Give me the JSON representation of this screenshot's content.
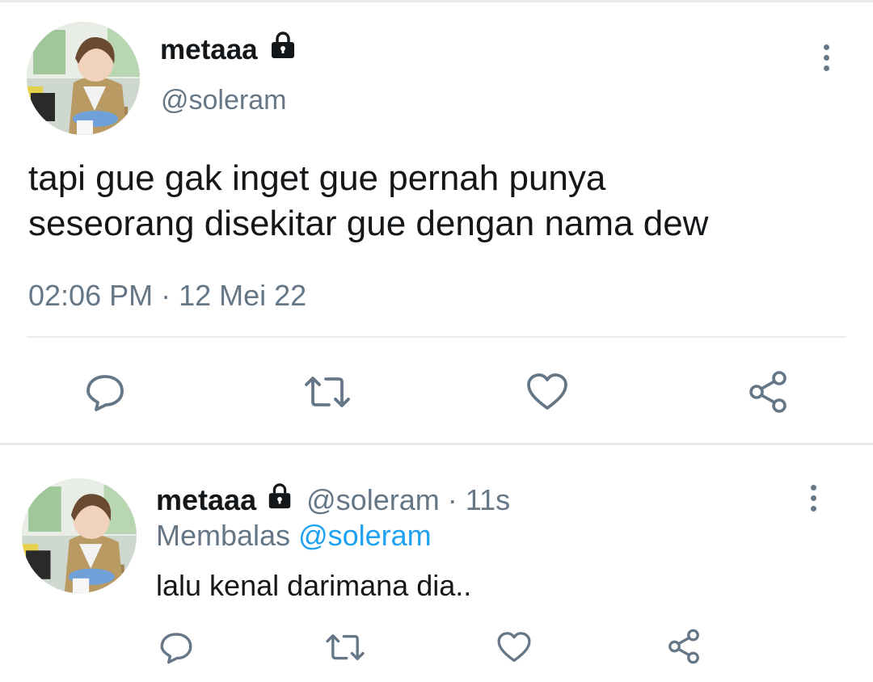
{
  "main_tweet": {
    "display_name": "metaaa",
    "handle": "@soleram",
    "text_line1": "tapi gue gak inget gue pernah punya",
    "text_line2": "seseorang disekitar gue dengan nama dew",
    "timestamp": "02:06 PM · 12 Mei 22"
  },
  "reply": {
    "display_name": "metaaa",
    "handle_time": "@soleram · 11s",
    "replying_prefix": "Membalas",
    "replying_to": "@soleram",
    "text": "lalu kenal darimana dia.."
  },
  "icons": {
    "lock": "lock-icon",
    "more": "more-vertical-icon",
    "reply": "comment-icon",
    "retweet": "retweet-icon",
    "like": "heart-icon",
    "share": "share-icon"
  },
  "colors": {
    "text_primary": "#14171a",
    "text_secondary": "#657786",
    "link": "#1da1f2",
    "divider": "#e6ecf0"
  }
}
